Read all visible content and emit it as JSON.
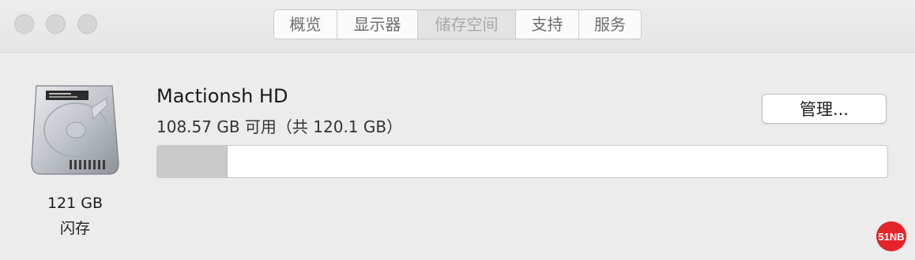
{
  "window": {
    "tabs": [
      {
        "label": "概览",
        "active": false
      },
      {
        "label": "显示器",
        "active": false
      },
      {
        "label": "储存空间",
        "active": true
      },
      {
        "label": "支持",
        "active": false
      },
      {
        "label": "服务",
        "active": false
      }
    ]
  },
  "storage": {
    "drive_icon": "hard-drive-icon",
    "capacity_label": "121 GB",
    "type_label": "闪存",
    "disk_name": "Mactionsh HD",
    "available_text": "108.57 GB 可用（共 120.1 GB）",
    "manage_button": "管理...",
    "used_fraction": 0.096
  },
  "watermark": {
    "text": "51NB",
    "color": "#e5232a"
  }
}
